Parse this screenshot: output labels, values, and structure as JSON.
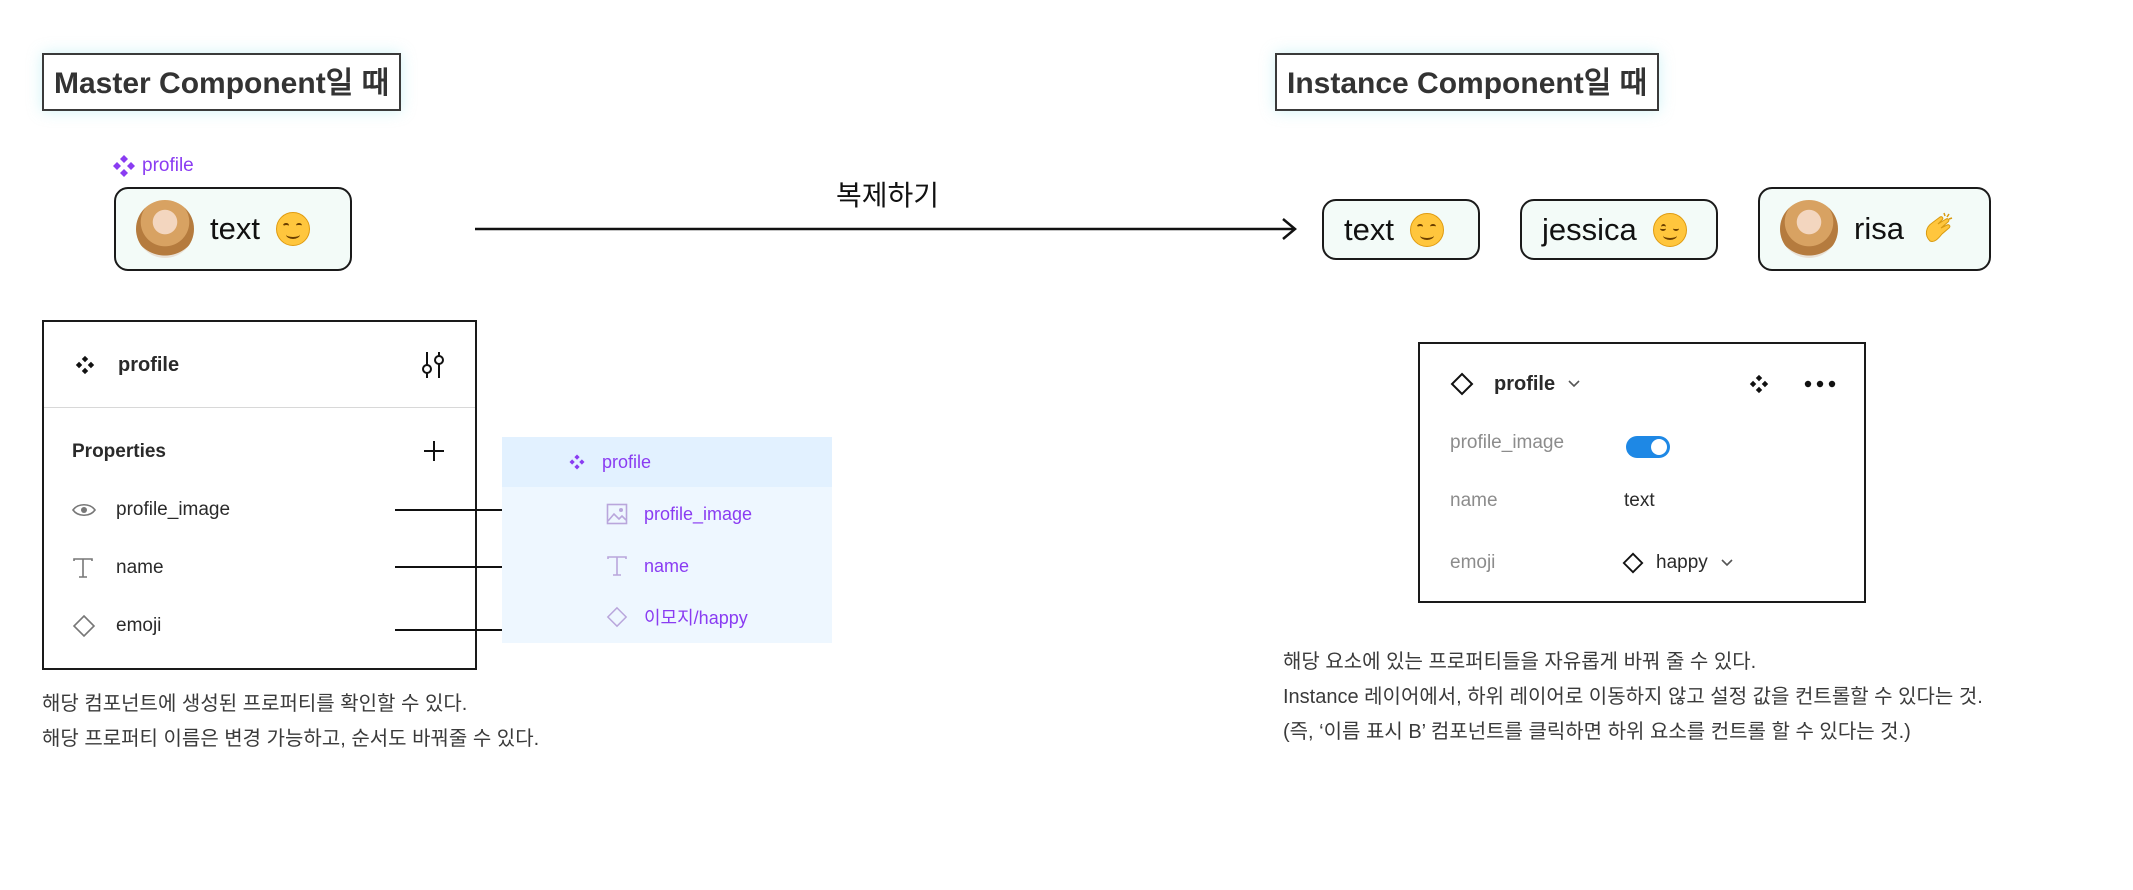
{
  "titles": {
    "master": "Master Component일 때",
    "instance": "Instance Component일 때"
  },
  "arrow_label": "복제하기",
  "master": {
    "tag": "profile",
    "chip_text": "text",
    "chip_emoji": "smiling-face-emoji"
  },
  "instances": [
    {
      "text": "text",
      "emoji": "smiling-face-emoji",
      "avatar": false
    },
    {
      "text": "jessica",
      "emoji": "relieved-face-emoji",
      "avatar": false
    },
    {
      "text": "risa",
      "emoji": "clapping-hands-emoji",
      "avatar": true
    }
  ],
  "master_panel": {
    "title": "profile",
    "properties_label": "Properties",
    "properties": [
      {
        "icon": "eye-icon",
        "label": "profile_image"
      },
      {
        "icon": "text-type-icon",
        "label": "name"
      },
      {
        "icon": "diamond-icon",
        "label": "emoji"
      }
    ]
  },
  "layers": {
    "root": "profile",
    "items": [
      {
        "icon": "image-icon",
        "label": "profile_image"
      },
      {
        "icon": "text-type-icon",
        "label": "name"
      },
      {
        "icon": "diamond-icon",
        "label": "이모지/happy"
      }
    ]
  },
  "instance_panel": {
    "title": "profile",
    "rows": [
      {
        "label": "profile_image",
        "value_type": "toggle",
        "value": "on"
      },
      {
        "label": "name",
        "value": "text"
      },
      {
        "label": "emoji",
        "value": "happy"
      }
    ]
  },
  "master_desc": [
    "해당 컴포넌트에 생성된 프로퍼티를 확인할 수 있다.",
    "해당 프로퍼티 이름은 변경 가능하고, 순서도 바꿔줄 수 있다."
  ],
  "instance_desc": [
    "해당 요소에 있는 프로퍼티들을 자유롭게 바꿔 줄 수 있다.",
    "Instance 레이어에서, 하위 레이어로 이동하지 않고 설정 값을 컨트롤할 수 있다는 것.",
    "(즉, ‘이름 표시 B’ 컴포넌트를 클릭하면 하위 요소를 컨트롤 할 수 있다는 것.)"
  ],
  "colors": {
    "accent_purple": "#8a3cf2",
    "toggle_blue": "#1e88e5",
    "layers_bg": "#eef7ff",
    "chip_bg": "#f3fbf8"
  }
}
